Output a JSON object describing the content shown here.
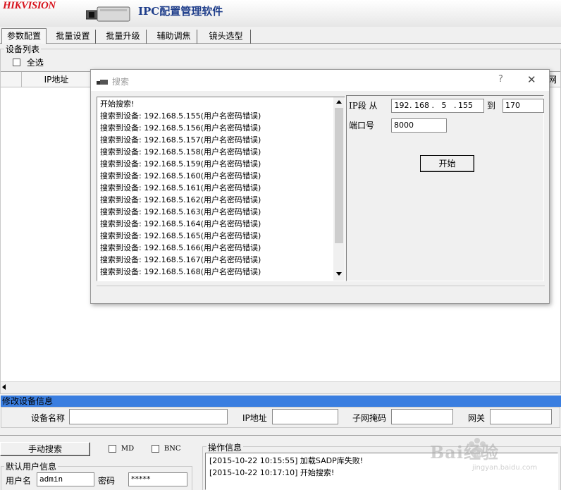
{
  "header": {
    "brand": "HIKVISION",
    "app_title": "IPC配置管理软件"
  },
  "tabs": [
    {
      "label": "参数配置",
      "active": true
    },
    {
      "label": "批量设置",
      "active": false
    },
    {
      "label": "批量升级",
      "active": false
    },
    {
      "label": "辅助调焦",
      "active": false
    },
    {
      "label": "镜头选型",
      "active": false
    }
  ],
  "device_list": {
    "section_label": "设备列表",
    "select_all": "全选",
    "col_ip": "IP地址",
    "col_gateway_partial": "网关"
  },
  "search_dialog": {
    "title": "搜索",
    "help": "?",
    "close": "✕",
    "log": [
      "开始搜索!",
      "搜索到设备: 192.168.5.155(用户名密码错误)",
      "搜索到设备: 192.168.5.156(用户名密码错误)",
      "搜索到设备: 192.168.5.157(用户名密码错误)",
      "搜索到设备: 192.168.5.158(用户名密码错误)",
      "搜索到设备: 192.168.5.159(用户名密码错误)",
      "搜索到设备: 192.168.5.160(用户名密码错误)",
      "搜索到设备: 192.168.5.161(用户名密码错误)",
      "搜索到设备: 192.168.5.162(用户名密码错误)",
      "搜索到设备: 192.168.5.163(用户名密码错误)",
      "搜索到设备: 192.168.5.164(用户名密码错误)",
      "搜索到设备: 192.168.5.165(用户名密码错误)",
      "搜索到设备: 192.168.5.166(用户名密码错误)",
      "搜索到设备: 192.168.5.167(用户名密码错误)",
      "搜索到设备: 192.168.5.168(用户名密码错误)"
    ],
    "ip_range_label": "IP段 从",
    "ip_from": [
      "192",
      "168",
      "5",
      "155"
    ],
    "to_label": "到",
    "ip_to": "170",
    "port_label": "端口号",
    "port_value": "8000",
    "start_button": "开始"
  },
  "modify": {
    "header": "修改设备信息",
    "device_name_label": "设备名称",
    "ip_label": "IP地址",
    "subnet_label": "子网掩码",
    "gateway_label": "网关"
  },
  "bottom": {
    "manual_search": "手动搜索",
    "md_label": "MD",
    "bnc_label": "BNC",
    "default_user_label": "默认用户信息",
    "username_label": "用户名",
    "username_value": "admin",
    "password_label": "密码",
    "password_value": "*****",
    "oplog_label": "操作信息",
    "oplog": [
      "[2015-10-22 10:15:55] 加载SADP库失败!",
      "[2015-10-22 10:17:10] 开始搜索!"
    ]
  },
  "watermark": {
    "text": "Bai经验",
    "sub": "jingyan.baidu.com"
  },
  "colors": {
    "brand_red": "#d8141e",
    "title_blue": "#1e3d8a",
    "highlight_blue": "#3a7ee0"
  }
}
